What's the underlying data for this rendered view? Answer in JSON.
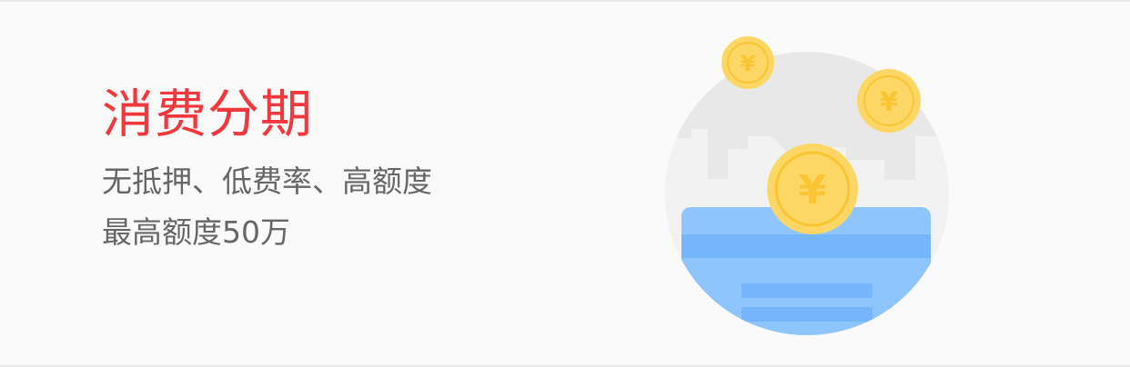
{
  "banner": {
    "title": "消费分期",
    "features": "无抵押、低费率、高额度",
    "limit": "最高额度50万"
  },
  "colors": {
    "title": "#f1383d",
    "body_text": "#666666",
    "background": "#fafafa",
    "coin": "#fdd765",
    "coin_ring": "#f9c532",
    "card": "#8ec5fd",
    "card_stripe": "#75b6fb",
    "circle": "#e8e8e8",
    "buildings": "#f2f2f2"
  },
  "icons": {
    "coin_symbol": "¥",
    "illustration": "coins-over-card-illustration"
  }
}
